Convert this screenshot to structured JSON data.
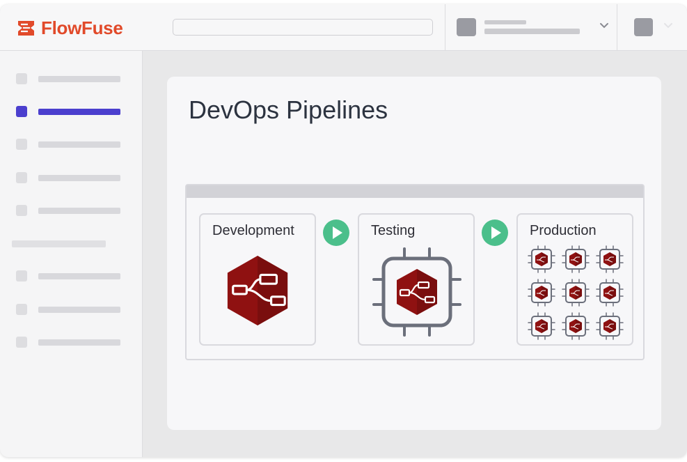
{
  "brand": {
    "name": "FlowFuse",
    "color": "#e14a2a"
  },
  "search": {
    "placeholder": ""
  },
  "sidebar": {
    "active_index": 1,
    "active_color": "#4b3fce"
  },
  "main": {
    "title": "DevOps Pipelines"
  },
  "pipeline": {
    "stages": [
      {
        "label": "Development",
        "icon": "node-red-hexagon-icon"
      },
      {
        "label": "Testing",
        "icon": "chip-node-red-icon"
      },
      {
        "label": "Production",
        "icon": "chip-grid-icon",
        "instances": 9
      }
    ],
    "run_button_color": "#4bbf8b"
  },
  "icons": {
    "node_red_color": "#8f1111",
    "chip_outline_color": "#6b6f7b"
  }
}
